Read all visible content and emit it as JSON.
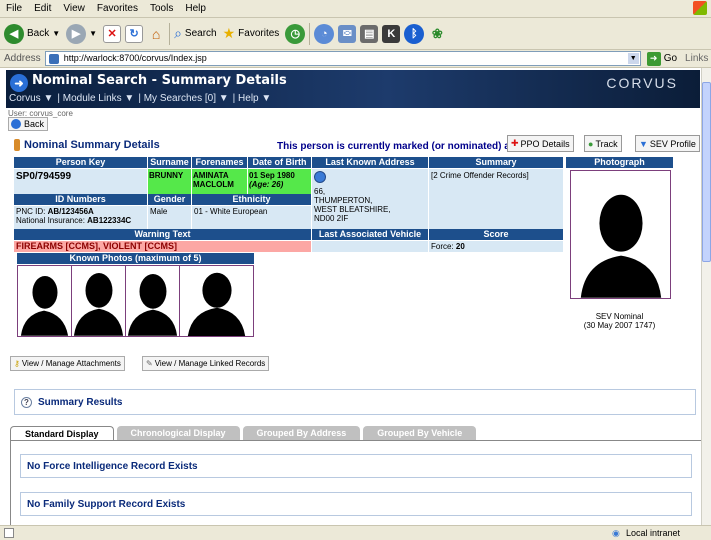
{
  "browser": {
    "menu": [
      "File",
      "Edit",
      "View",
      "Favorites",
      "Tools",
      "Help"
    ],
    "toolbar": {
      "back": "Back",
      "search": "Search",
      "favorites": "Favorites"
    },
    "address": {
      "label": "Address",
      "url": "http://warlock:8700/corvus/Index.jsp",
      "go": "Go",
      "links": "Links"
    },
    "status": {
      "zone": "Local intranet"
    }
  },
  "app": {
    "title": "Nominal Search - Summary Details",
    "brand": "CORVUS",
    "nav": [
      "Corvus ▼",
      "| Module Links ▼",
      "| My Searches [0] ▼",
      "| Help ▼"
    ],
    "user": "User: corvus_core",
    "back": "Back"
  },
  "summary": {
    "heading": "Nominal Summary Details",
    "ppo_notice": "This person is currently marked (or nominated) as a PPO.",
    "buttons": {
      "ppo": "PPO Details",
      "track": "Track",
      "sev": "SEV Profile"
    },
    "headers": {
      "person_key": "Person Key",
      "surname": "Surname",
      "forenames": "Forenames",
      "dob": "Date of Birth",
      "address": "Last Known Address",
      "summary": "Summary",
      "photo": "Photograph",
      "id_numbers": "ID Numbers",
      "gender": "Gender",
      "ethnicity": "Ethnicity",
      "warning": "Warning Text",
      "vehicle": "Last Associated Vehicle",
      "score": "Score",
      "known_photos": "Known Photos (maximum of 5)"
    },
    "person_key": "SP0/794599",
    "surname": "BRUNNY",
    "forenames": [
      "AMINATA",
      "MACLOLM"
    ],
    "dob": "01 Sep 1980",
    "age": "(Age: 26)",
    "address": [
      "66,",
      "THUMPERTON,",
      "WEST BLEATSHIRE,",
      "ND00 2IF"
    ],
    "summary_text": "[2 Crime Offender Records]",
    "pnc_label": "PNC ID: ",
    "pnc": "AB/123456A",
    "ni_label": "National Insurance: ",
    "ni": "AB122334C",
    "gender": "Male",
    "ethnicity": "01 - White European",
    "warning_text": "FIREARMS [CCMS], VIOLENT [CCMS]",
    "score_label": "Force: ",
    "score": "20",
    "photo_caption": [
      "SEV Nominal",
      "(30 May 2007 1747)"
    ]
  },
  "actions": {
    "attachments": "View / Manage Attachments",
    "linked": "View / Manage Linked Records"
  },
  "results": {
    "heading": "Summary Results",
    "tabs": [
      "Standard Display",
      "Chronological Display",
      "Grouped By Address",
      "Grouped By Vehicle"
    ],
    "records": [
      "No Force Intelligence Record Exists",
      "No Family Support Record Exists"
    ]
  }
}
